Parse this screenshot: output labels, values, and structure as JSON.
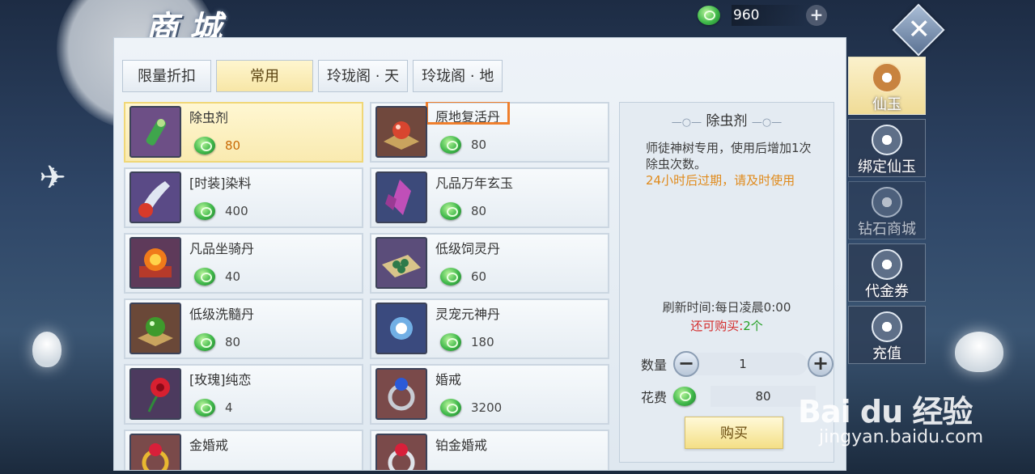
{
  "header": {
    "title": "商城",
    "currency_value": "960",
    "add_label": "+",
    "close_label": "✕"
  },
  "tabs": [
    {
      "label": "限量折扣"
    },
    {
      "label": "常用"
    },
    {
      "label": "玲珑阁 · 天"
    },
    {
      "label": "玲珑阁 · 地"
    }
  ],
  "items": [
    {
      "name": "除虫剂",
      "price": "80",
      "icon": "insecticide-bottle-icon",
      "bg": "#6d4f86"
    },
    {
      "name": "原地复活丹",
      "price": "80",
      "icon": "revive-pill-icon",
      "bg": "#70483d"
    },
    {
      "name": "[时装]染料",
      "price": "400",
      "icon": "dye-icon",
      "bg": "#5a4a86"
    },
    {
      "name": "凡品万年玄玉",
      "price": "80",
      "icon": "jade-crystal-icon",
      "bg": "#3c4a7a"
    },
    {
      "name": "凡品坐骑丹",
      "price": "40",
      "icon": "mount-pill-icon",
      "bg": "#5e3a5a"
    },
    {
      "name": "低级饲灵丹",
      "price": "60",
      "icon": "feed-pill-icon",
      "bg": "#5b4d7a"
    },
    {
      "name": "低级洗髓丹",
      "price": "80",
      "icon": "marrow-pill-icon",
      "bg": "#6a4838"
    },
    {
      "name": "灵宠元神丹",
      "price": "180",
      "icon": "spirit-orb-icon",
      "bg": "#3a4a7e"
    },
    {
      "name": "[玫瑰]纯恋",
      "price": "4",
      "icon": "rose-icon",
      "bg": "#4c3a5e"
    },
    {
      "name": "婚戒",
      "price": "3200",
      "icon": "ring-icon",
      "bg": "#7a4a4a"
    },
    {
      "name": "金婚戒",
      "price": "",
      "icon": "gold-ring-icon",
      "bg": "#7a4a4a"
    },
    {
      "name": "铂金婚戒",
      "price": "",
      "icon": "platinum-ring-icon",
      "bg": "#7a4a4a"
    }
  ],
  "detail": {
    "title": "除虫剂",
    "description": "师徒神树专用，使用后增加1次除虫次数。",
    "warning": "24小时后过期，请及时使用",
    "refresh": "刷新时间:每日凌晨0:00",
    "remain_prefix": "还可购买:",
    "remain_count": "2个",
    "qty_label": "数量",
    "qty_value": "1",
    "cost_label": "花费",
    "cost_value": "80",
    "buy_label": "购买"
  },
  "sidenav": [
    {
      "label": "仙玉"
    },
    {
      "label": "绑定仙玉"
    },
    {
      "label": "钻石商城"
    },
    {
      "label": "代金券"
    },
    {
      "label": "充值"
    }
  ],
  "watermark": {
    "main": "Bai du 经验",
    "sub": "jingyan.baidu.com"
  },
  "colors": {
    "highlight_border": "#ef7f2d",
    "selected_bg": "#fff7d2",
    "warning": "#e08a1b",
    "remain": "#d42c2c"
  }
}
